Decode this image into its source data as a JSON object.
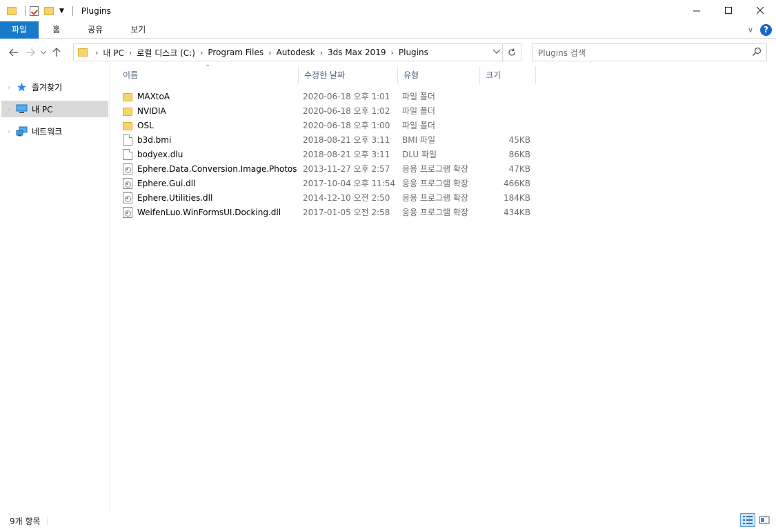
{
  "window": {
    "title": "Plugins",
    "minimize_icon": "minimize-icon",
    "maximize_icon": "maximize-icon",
    "close_icon": "close-icon"
  },
  "ribbon": {
    "tabs": [
      {
        "label": "파일",
        "active": true
      },
      {
        "label": "홈",
        "active": false
      },
      {
        "label": "공유",
        "active": false
      },
      {
        "label": "보기",
        "active": false
      }
    ],
    "help_label": "?"
  },
  "address": {
    "breadcrumbs": [
      "내 PC",
      "로컬 디스크 (C:)",
      "Program Files",
      "Autodesk",
      "3ds Max 2019",
      "Plugins"
    ]
  },
  "search": {
    "placeholder": "Plugins 검색"
  },
  "sidebar": {
    "items": [
      {
        "label": "즐겨찾기",
        "icon": "star-icon",
        "selected": false
      },
      {
        "label": "내 PC",
        "icon": "pc-icon",
        "selected": true
      },
      {
        "label": "네트워크",
        "icon": "network-icon",
        "selected": false
      }
    ]
  },
  "columns": [
    "이름",
    "수정한 날짜",
    "유형",
    "크기"
  ],
  "files": [
    {
      "name": "MAXtoA",
      "date": "2020-06-18 오후 1:01",
      "type": "파일 폴더",
      "size": "",
      "icon": "folder-icon"
    },
    {
      "name": "NVIDIA",
      "date": "2020-06-18 오후 1:02",
      "type": "파일 폴더",
      "size": "",
      "icon": "folder-icon"
    },
    {
      "name": "OSL",
      "date": "2020-06-18 오후 1:00",
      "type": "파일 폴더",
      "size": "",
      "icon": "folder-icon"
    },
    {
      "name": "b3d.bmi",
      "date": "2018-08-21 오후 3:11",
      "type": "BMI 파일",
      "size": "45KB",
      "icon": "file-icon"
    },
    {
      "name": "bodyex.dlu",
      "date": "2018-08-21 오후 3:11",
      "type": "DLU 파일",
      "size": "86KB",
      "icon": "file-icon"
    },
    {
      "name": "Ephere.Data.Conversion.Image.Photosho...",
      "date": "2013-11-27 오후 2:57",
      "type": "응용 프로그램 확장",
      "size": "47KB",
      "icon": "dll-icon"
    },
    {
      "name": "Ephere.Gui.dll",
      "date": "2017-10-04 오후 11:54",
      "type": "응용 프로그램 확장",
      "size": "466KB",
      "icon": "dll-icon"
    },
    {
      "name": "Ephere.Utilities.dll",
      "date": "2014-12-10 오전 2:50",
      "type": "응용 프로그램 확장",
      "size": "184KB",
      "icon": "dll-icon"
    },
    {
      "name": "WeifenLuo.WinFormsUI.Docking.dll",
      "date": "2017-01-05 오전 2:58",
      "type": "응용 프로그램 확장",
      "size": "434KB",
      "icon": "dll-icon"
    }
  ],
  "status": {
    "item_count": "9개 항목"
  },
  "colors": {
    "accent": "#1979ca",
    "folder": "#f7d36b",
    "selected": "#d9d9d9"
  }
}
